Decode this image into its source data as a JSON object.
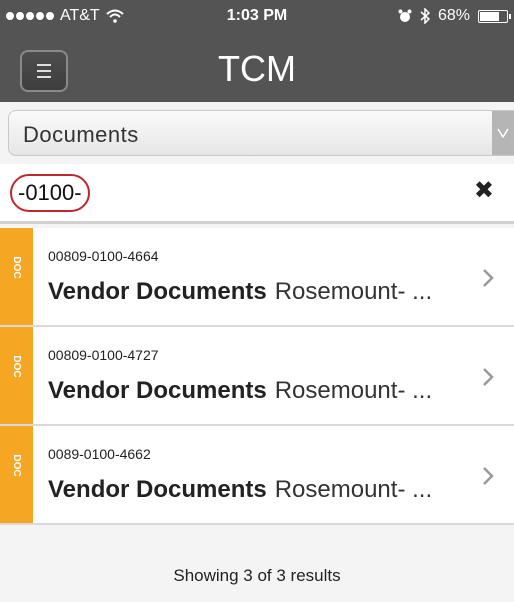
{
  "status_bar": {
    "carrier": "AT&T",
    "time": "1:03 PM",
    "battery_text": "68%",
    "battery_level": 0.68
  },
  "header": {
    "title": "TCM"
  },
  "filter": {
    "selected": "Documents"
  },
  "search": {
    "query": "-0100-"
  },
  "results": [
    {
      "tag": "DOC",
      "number": "00809-0100-4664",
      "type": "Vendor Documents",
      "name": "Rosemount- ..."
    },
    {
      "tag": "DOC",
      "number": "00809-0100-4727",
      "type": "Vendor Documents",
      "name": "Rosemount- ..."
    },
    {
      "tag": "DOC",
      "number": "0089-0100-4662",
      "type": "Vendor Documents",
      "name": "Rosemount- ..."
    }
  ],
  "footer": {
    "summary": "Showing 3 of 3 results"
  },
  "colors": {
    "header_bg": "#545454",
    "doc_tag": "#f5a623",
    "search_highlight": "#c0272d"
  }
}
